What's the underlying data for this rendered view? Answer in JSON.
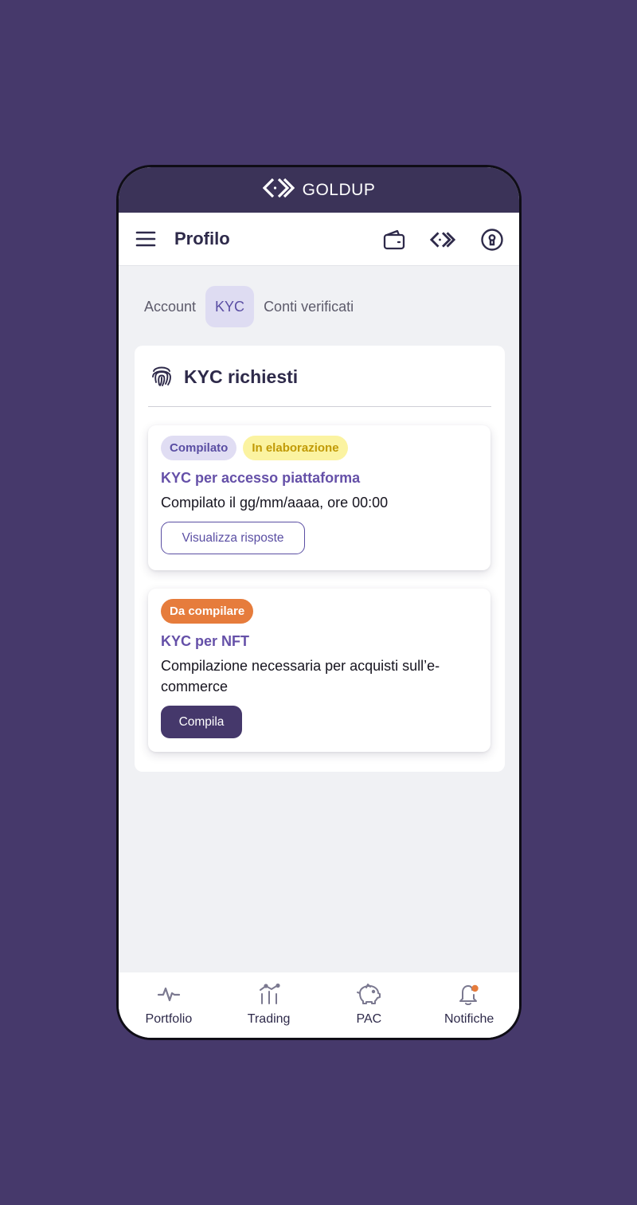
{
  "brand": {
    "name_light": "GOLD",
    "name_bold": "UP"
  },
  "header": {
    "title": "Profilo"
  },
  "tabs": [
    {
      "label": "Account",
      "active": false
    },
    {
      "label": "KYC",
      "active": true
    },
    {
      "label": "Conti verificati",
      "active": false
    }
  ],
  "kyc_section": {
    "title": "KYC richiesti",
    "items": [
      {
        "badges": [
          "Compilato",
          "In elaborazione"
        ],
        "title": "KYC per accesso piattaforma",
        "description": "Compilato il gg/mm/aaaa, ore 00:00",
        "button_label": "Visualizza risposte"
      },
      {
        "badges": [
          "Da compilare"
        ],
        "title": "KYC per NFT",
        "description": "Compilazione necessaria per acquisti sull’e-commerce",
        "button_label": "Compila"
      }
    ]
  },
  "bottom_nav": [
    {
      "label": "Portfolio",
      "icon": "activity-icon"
    },
    {
      "label": "Trading",
      "icon": "trading-icon"
    },
    {
      "label": "PAC",
      "icon": "piggy-bank-icon"
    },
    {
      "label": "Notifiche",
      "icon": "bell-icon"
    }
  ],
  "colors": {
    "background": "#46396b",
    "primary": "#45386b",
    "accent": "#5a4ea3",
    "warning_badge": "#fbf3a1",
    "todo_badge": "#e67c3c",
    "notification_dot": "#e67c3c"
  }
}
